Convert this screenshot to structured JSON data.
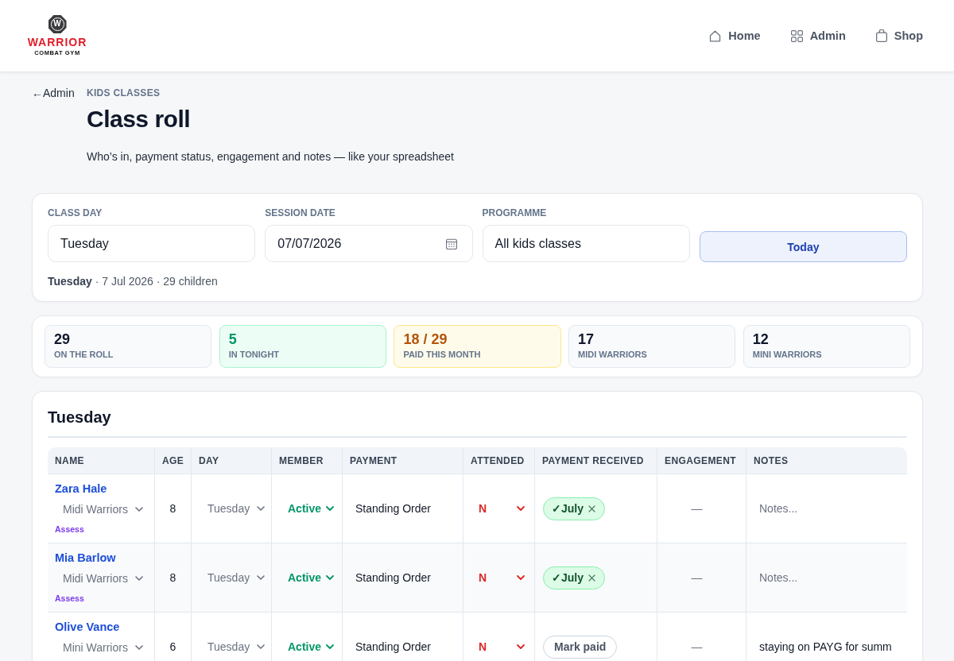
{
  "header": {
    "logo": {
      "mark": "W",
      "name": "WARRIOR",
      "tagline": "COMBAT GYM"
    },
    "nav": [
      "Home",
      "Admin",
      "Shop"
    ]
  },
  "back_link": "←Admin",
  "page": {
    "eyebrow": "KIDS CLASSES",
    "title": "Class roll",
    "subtitle": "Who’s in, payment status, engagement and notes — like your spreadsheet"
  },
  "filters": {
    "fields": [
      {
        "label": "CLASS DAY",
        "value": "Tuesday",
        "kind": "text"
      },
      {
        "label": "SESSION DATE",
        "value": "07/07/2026",
        "kind": "date"
      },
      {
        "label": "PROGRAMME",
        "value": "All kids classes",
        "kind": "text"
      }
    ],
    "button": "Today",
    "summary": "**Tuesday** · 7 Jul 2026 · 29 children"
  },
  "stats": [
    {
      "value": "29",
      "label": "ON THE ROLL",
      "kind": "neutral"
    },
    {
      "value": "5",
      "label": "IN TONIGHT",
      "kind": "success"
    },
    {
      "value": "18 / 29",
      "label": "PAID THIS MONTH",
      "kind": "warning"
    },
    {
      "value": "17",
      "label": "MIDI WARRIORS",
      "kind": "neutral"
    },
    {
      "value": "12",
      "label": "MINI WARRIORS",
      "kind": "neutral"
    }
  ],
  "roll": {
    "title": "Tuesday",
    "columns": [
      "NAME",
      "AGE",
      "DAY",
      "MEMBER",
      "PAYMENT",
      "ATTENDED",
      "PAYMENT RECEIVED",
      "ENGAGEMENT",
      "NOTES"
    ],
    "rows": [
      {
        "name": "Zara Hale",
        "group": "Midi Warriors",
        "tag": "Assess",
        "age": "8",
        "day": "Tuesday",
        "member": "Active",
        "payment": "Standing Order",
        "attended": "N",
        "payment_received": {
          "kind": "paid",
          "label": "✓July"
        },
        "engagement": "—",
        "notes": {
          "placeholder": "Notes..."
        }
      },
      {
        "name": "Mia Barlow",
        "group": "Midi Warriors",
        "tag": "Assess",
        "age": "8",
        "day": "Tuesday",
        "member": "Active",
        "payment": "Standing Order",
        "attended": "N",
        "payment_received": {
          "kind": "paid",
          "label": "✓July"
        },
        "engagement": "—",
        "notes": {
          "placeholder": "Notes..."
        }
      },
      {
        "name": "Olive Vance",
        "group": "Mini Warriors",
        "age": "6",
        "day": "Tuesday",
        "member": "Active",
        "payment": "Standing Order",
        "attended": "N",
        "payment_received": {
          "kind": "unpaid",
          "label": "Mark paid"
        },
        "engagement": "—",
        "notes": {
          "value": "staying on PAYG for summ"
        }
      }
    ]
  }
}
